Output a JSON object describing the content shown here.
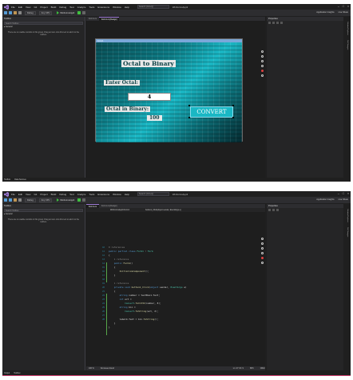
{
  "menu": [
    "File",
    "Edit",
    "View",
    "Git",
    "Project",
    "Build",
    "Debug",
    "Test",
    "Analyze",
    "Tools",
    "Extensions",
    "Window",
    "Help"
  ],
  "search_placeholder": "Search (Ctrl+Q)",
  "solution_name": "WinFormsApp3",
  "toolbar": {
    "config": "Debug",
    "platform": "Any CPU",
    "run_label": "WinFormsApp3",
    "insights": "Application Insights",
    "live_share": "Live Share"
  },
  "toolbox": {
    "title": "Toolbox",
    "search": "Search Toolbox",
    "group": "General",
    "empty_text": "There are no usable controls in this group. Drag an item onto this text to add it to the toolbox."
  },
  "properties": {
    "title": "Properties"
  },
  "side_tabs": [
    "Solution Explorer",
    "Git Changes"
  ],
  "designer": {
    "tabs": [
      "Form1.cs",
      "Form1.cs [Design]"
    ],
    "form_title": "Form1",
    "title_label": "Octal to Binary",
    "enter_label": "Enter Octal:",
    "input_value": "4",
    "binary_label": "Octal in Binary:",
    "result_value": "100",
    "button_label": "CONVERT"
  },
  "editor": {
    "tabs": [
      "Form1.cs",
      "Form1.cs [Design]"
    ],
    "breadcrumb": "WinFormsApp3.Form1",
    "member": "button1_Click(object sender, EventArgs e)",
    "line_numbers": [
      "10",
      "11",
      "12",
      "13",
      "14",
      "15",
      "16",
      "17",
      "18",
      "19",
      "20",
      "21",
      "22",
      "23",
      "24",
      "25",
      "26",
      "27",
      "28"
    ]
  },
  "status": {
    "ready": "Ready",
    "no_issues": "No issues found",
    "zoom": "100 %",
    "position": "Ln: 27  Ch: 9",
    "spc": "SPC",
    "crlf": "CRLF",
    "tabs_bottom": [
      "Toolbox",
      "Data Sources"
    ],
    "output": "Output"
  },
  "colors": {
    "accent": "#a07cd9",
    "form_bg": "#1ab7c4"
  }
}
